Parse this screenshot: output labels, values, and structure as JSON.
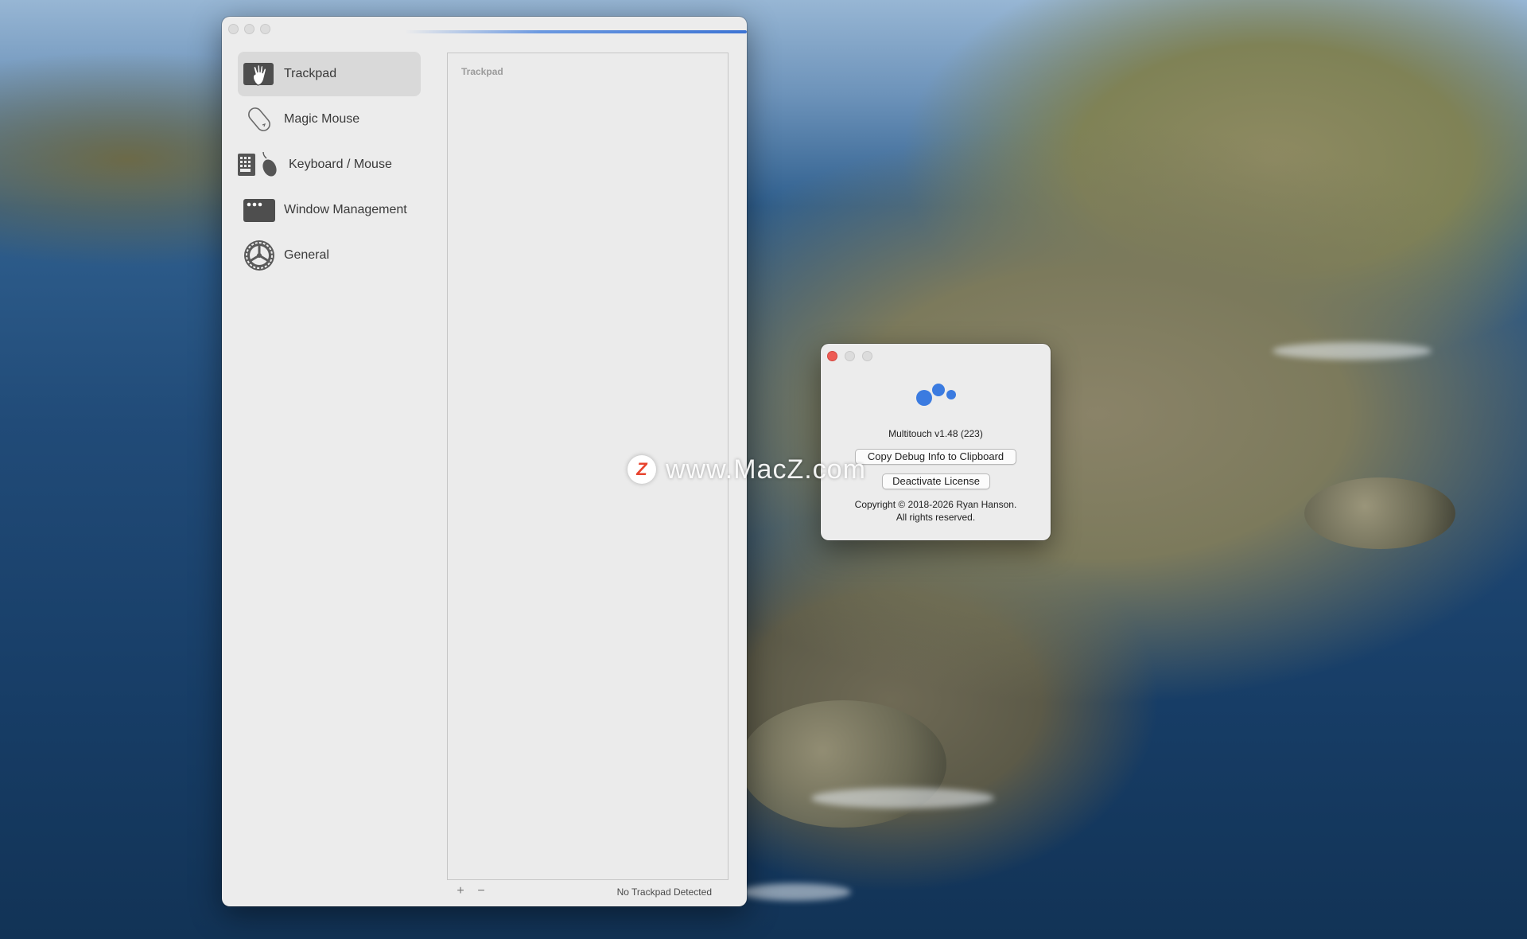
{
  "main_window": {
    "sidebar": {
      "items": [
        {
          "label": "Trackpad",
          "icon": "trackpad-hand-icon",
          "selected": true
        },
        {
          "label": "Magic Mouse",
          "icon": "magic-mouse-icon",
          "selected": false
        },
        {
          "label": "Keyboard / Mouse",
          "icon": "keyboard-mouse-icon",
          "selected": false
        },
        {
          "label": "Window Management",
          "icon": "window-management-icon",
          "selected": false
        },
        {
          "label": "General",
          "icon": "general-gear-icon",
          "selected": false
        }
      ]
    },
    "pane": {
      "title": "Trackpad"
    },
    "footer": {
      "add_label": "+",
      "remove_label": "−",
      "status": "No Trackpad Detected"
    }
  },
  "about_window": {
    "version": "Multitouch v1.48 (223)",
    "copy_debug_label": "Copy Debug Info to Clipboard",
    "deactivate_label": "Deactivate License",
    "copyright_line1": "Copyright © 2018-2026 Ryan Hanson.",
    "copyright_line2": "All rights reserved.",
    "logo_color": "#3b7be0"
  },
  "watermark": {
    "logo_letter": "Z",
    "text": "www.MacZ.com"
  }
}
